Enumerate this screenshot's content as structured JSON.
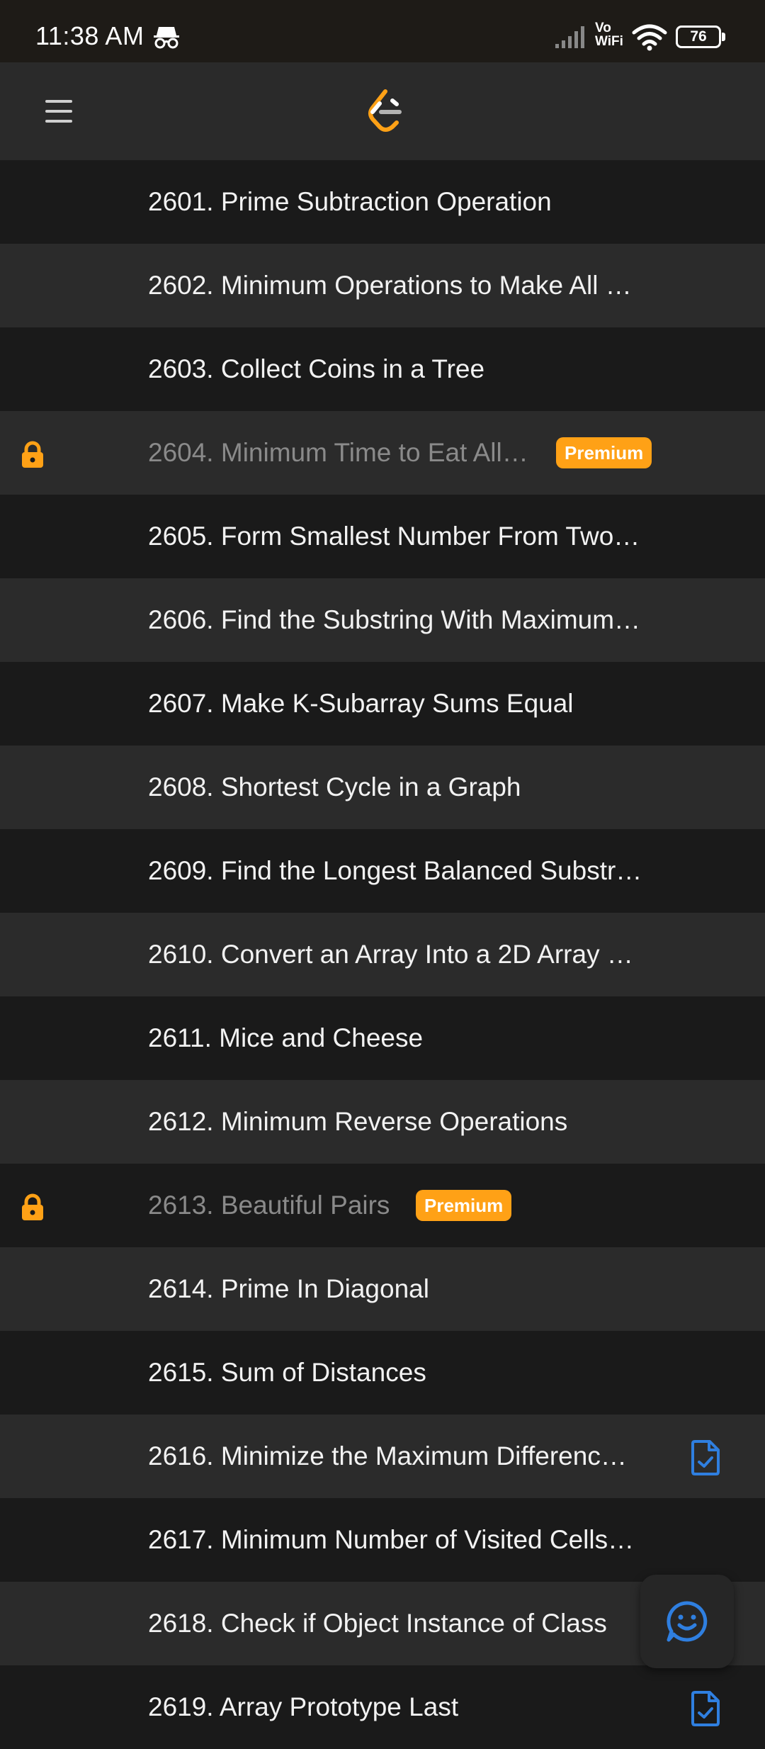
{
  "status_bar": {
    "time": "11:38 AM",
    "vo": "Vo",
    "wifi_text": "WiFi",
    "battery": "76",
    "icons": [
      "incognito-icon",
      "signal-icon",
      "wifi-icon",
      "battery-icon"
    ]
  },
  "app_bar": {
    "menu_icon": "menu-icon",
    "logo_icon": "leetcode-logo-icon"
  },
  "colors": {
    "accent": "#ffa116",
    "solution_blue": "#2f7fe0",
    "row_dark": "#1a1a1a",
    "row_light": "#2b2b2b"
  },
  "problems": [
    {
      "title": "2601. Prime Subtraction Operation",
      "locked": false
    },
    {
      "title": "2602. Minimum Operations to Make All …",
      "locked": false
    },
    {
      "title": "2603. Collect Coins in a Tree",
      "locked": false
    },
    {
      "title": "2604. Minimum Time to Eat All…",
      "locked": true,
      "badge": "Premium"
    },
    {
      "title": "2605. Form Smallest Number From Two…",
      "locked": false
    },
    {
      "title": "2606. Find the Substring With Maximum…",
      "locked": false
    },
    {
      "title": "2607. Make K-Subarray Sums Equal",
      "locked": false
    },
    {
      "title": "2608. Shortest Cycle in a Graph",
      "locked": false
    },
    {
      "title": "2609. Find the Longest Balanced Substr…",
      "locked": false
    },
    {
      "title": "2610. Convert an Array Into a 2D Array …",
      "locked": false
    },
    {
      "title": "2611. Mice and Cheese",
      "locked": false
    },
    {
      "title": "2612. Minimum Reverse Operations",
      "locked": false
    },
    {
      "title": "2613. Beautiful Pairs",
      "locked": true,
      "badge": "Premium"
    },
    {
      "title": "2614. Prime In Diagonal",
      "locked": false
    },
    {
      "title": "2615. Sum of Distances",
      "locked": false
    },
    {
      "title": "2616. Minimize the Maximum Differenc…",
      "locked": false,
      "solution": true
    },
    {
      "title": "2617. Minimum Number of Visited Cells…",
      "locked": false
    },
    {
      "title": "2618. Check if Object Instance of Class",
      "locked": false
    },
    {
      "title": "2619. Array Prototype Last",
      "locked": false,
      "solution": true
    }
  ],
  "feedback_fab": {
    "icon": "feedback-smiley-icon"
  }
}
